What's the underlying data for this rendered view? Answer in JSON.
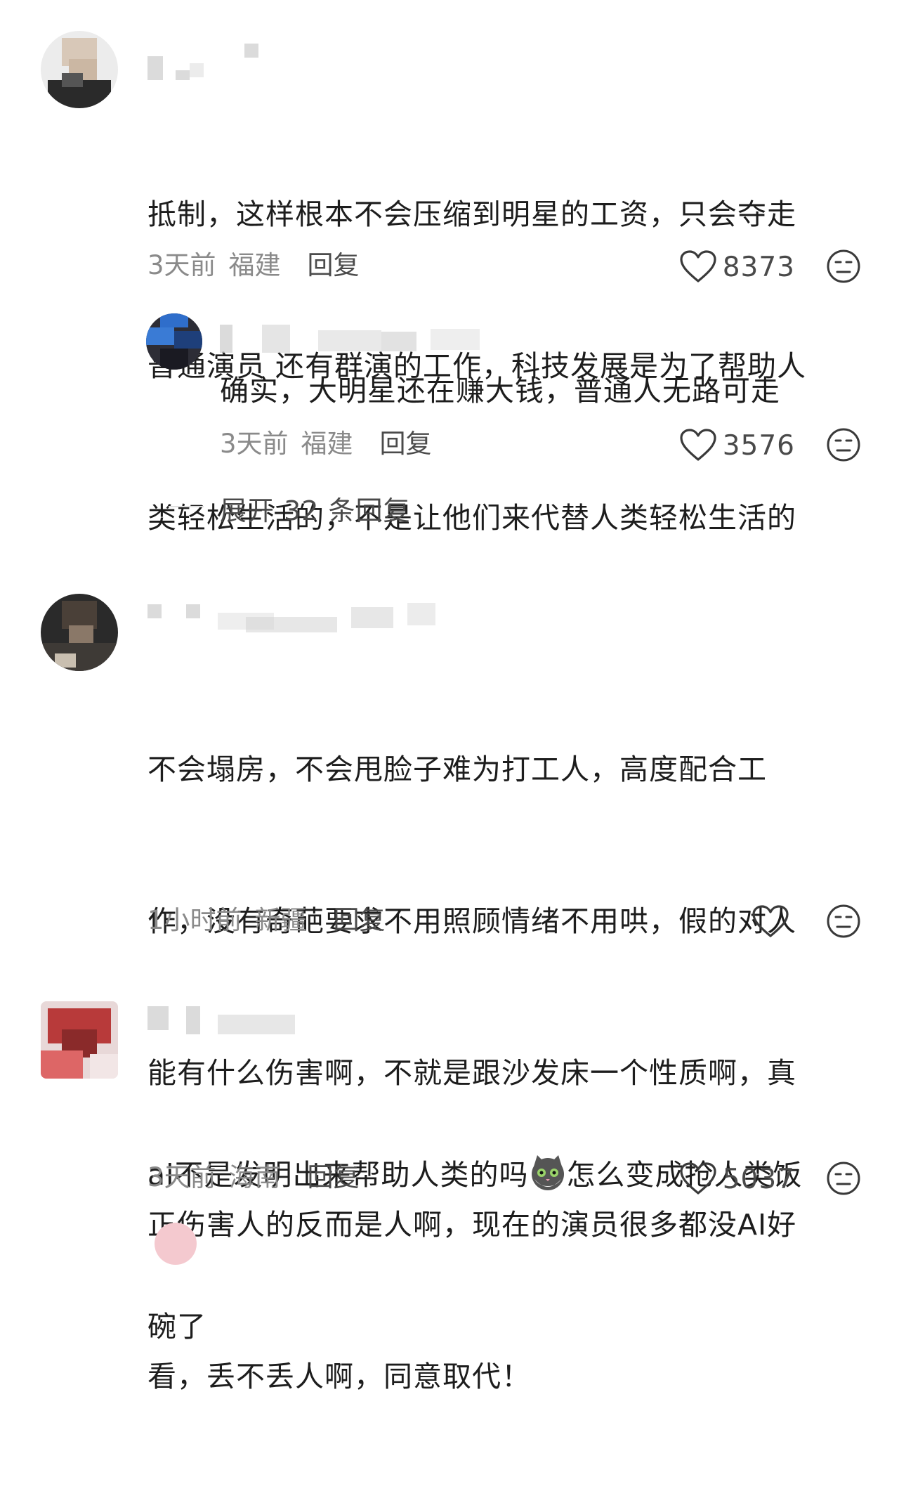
{
  "comments": [
    {
      "text": "抵制，这样根本不会压缩到明星的工资，只会夺走普通演员 还有群演的工作，科技发展是为了帮助人类轻松生活的，不是让他们来代替人类轻松生活的",
      "lines": [
        "抵制，这样根本不会压缩到明星的工资，只会夺走",
        "普通演员 还有群演的工作，科技发展是为了帮助人",
        "类轻松生活的，不是让他们来代替人类轻松生活的"
      ],
      "time": "3天前",
      "region": "福建",
      "reply_label": "回复",
      "likes": "8373",
      "replies": [
        {
          "text": "确实，大明星还在赚大钱，普通人无路可走",
          "time": "3天前",
          "region": "福建",
          "reply_label": "回复",
          "likes": "3576"
        }
      ],
      "expand_label": "展开 32 条回复"
    },
    {
      "lines": [
        "不会塌房，不会甩脸子难为打工人，高度配合工",
        "作，没有奇葩要求不用照顾情绪不用哄，假的对人",
        "能有什么伤害啊，不就是跟沙发床一个性质啊，真",
        "正伤害人的反而是人啊，现在的演员很多都没AI好",
        "看，丢不丢人啊，同意取代！"
      ],
      "time": "1小时前",
      "region": "新疆",
      "reply_label": "回复",
      "likes": ""
    },
    {
      "line1_before": "ai不是发明出来帮助人类的吗",
      "emoji": "cat-emoji",
      "line1_after": "怎么变成抢人类饭",
      "line2": "碗了",
      "time": "3天前",
      "region": "海南",
      "reply_label": "回复",
      "likes": "5037"
    }
  ],
  "icons": {
    "like": "heart-outline-icon",
    "dislike": "meh-face-icon"
  },
  "colors": {
    "text": "#1d1d1d",
    "meta": "#8a8a8a",
    "icon": "#3a3a3a"
  }
}
